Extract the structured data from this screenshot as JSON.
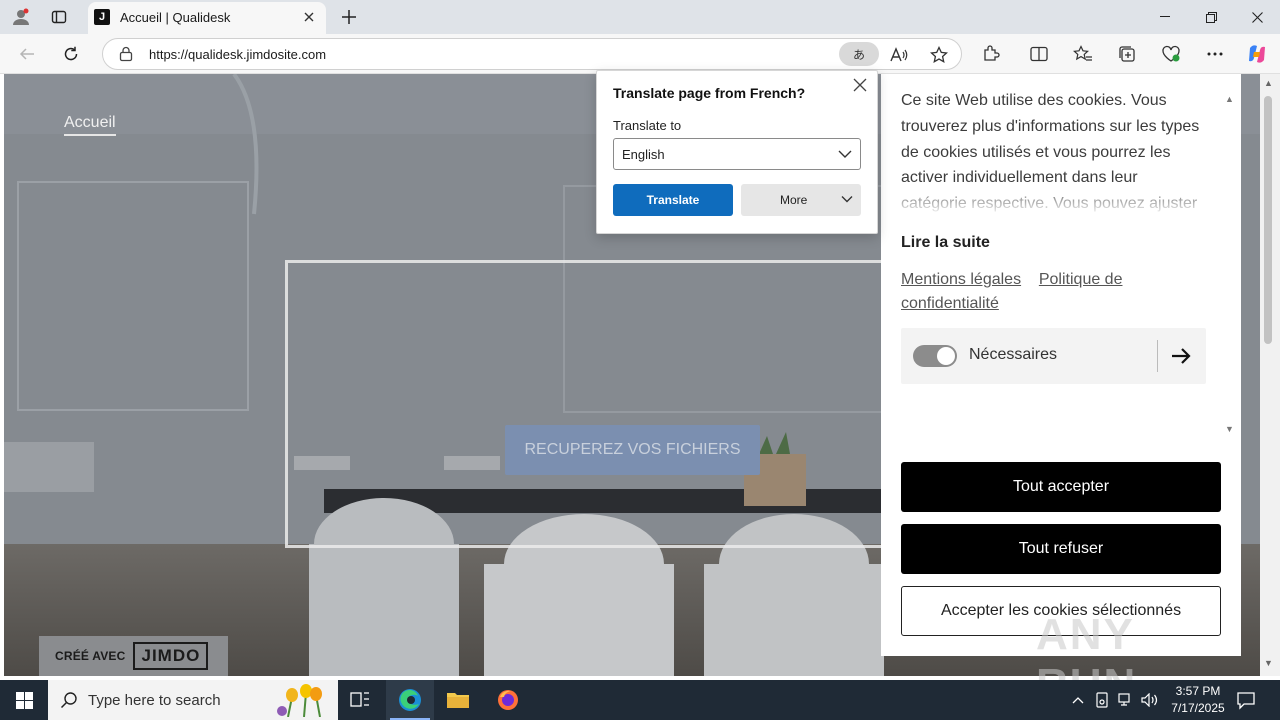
{
  "browser": {
    "tab_title": "Accueil | Qualidesk",
    "favicon_letter": "J",
    "url": "https://qualidesk.jimdosite.com",
    "translate_pill": "あ"
  },
  "page": {
    "nav_item": "Accueil",
    "cta_label": "RECUPEREZ VOS FICHIERS",
    "badge_prefix": "CRÉÉ AVEC",
    "badge_logo": "JIMDO"
  },
  "cookie": {
    "text": "Ce site Web utilise des cookies. Vous trouverez plus d'informations sur les types de cookies utilisés et vous pourrez les activer individuellement dans leur catégorie respective. Vous pouvez ajuster",
    "read_more": "Lire la suite",
    "link_legal": "Mentions légales",
    "link_privacy": "Politique de confidentialité",
    "toggle_label": "Nécessaires",
    "btn_accept_all": "Tout accepter",
    "btn_refuse_all": "Tout refuser",
    "btn_accept_selected": "Accepter les cookies sélectionnés"
  },
  "translate_popup": {
    "title": "Translate page from French?",
    "label": "Translate to",
    "selected_language": "English",
    "translate_btn": "Translate",
    "more_btn": "More"
  },
  "taskbar": {
    "search_placeholder": "Type here to search",
    "time": "3:57 PM",
    "date": "7/17/2025"
  },
  "watermark": "ANY RUN",
  "colors": {
    "translate_blue": "#0f6cbd",
    "taskbar": "#1f2a36",
    "cta": "#7b8fb0"
  }
}
